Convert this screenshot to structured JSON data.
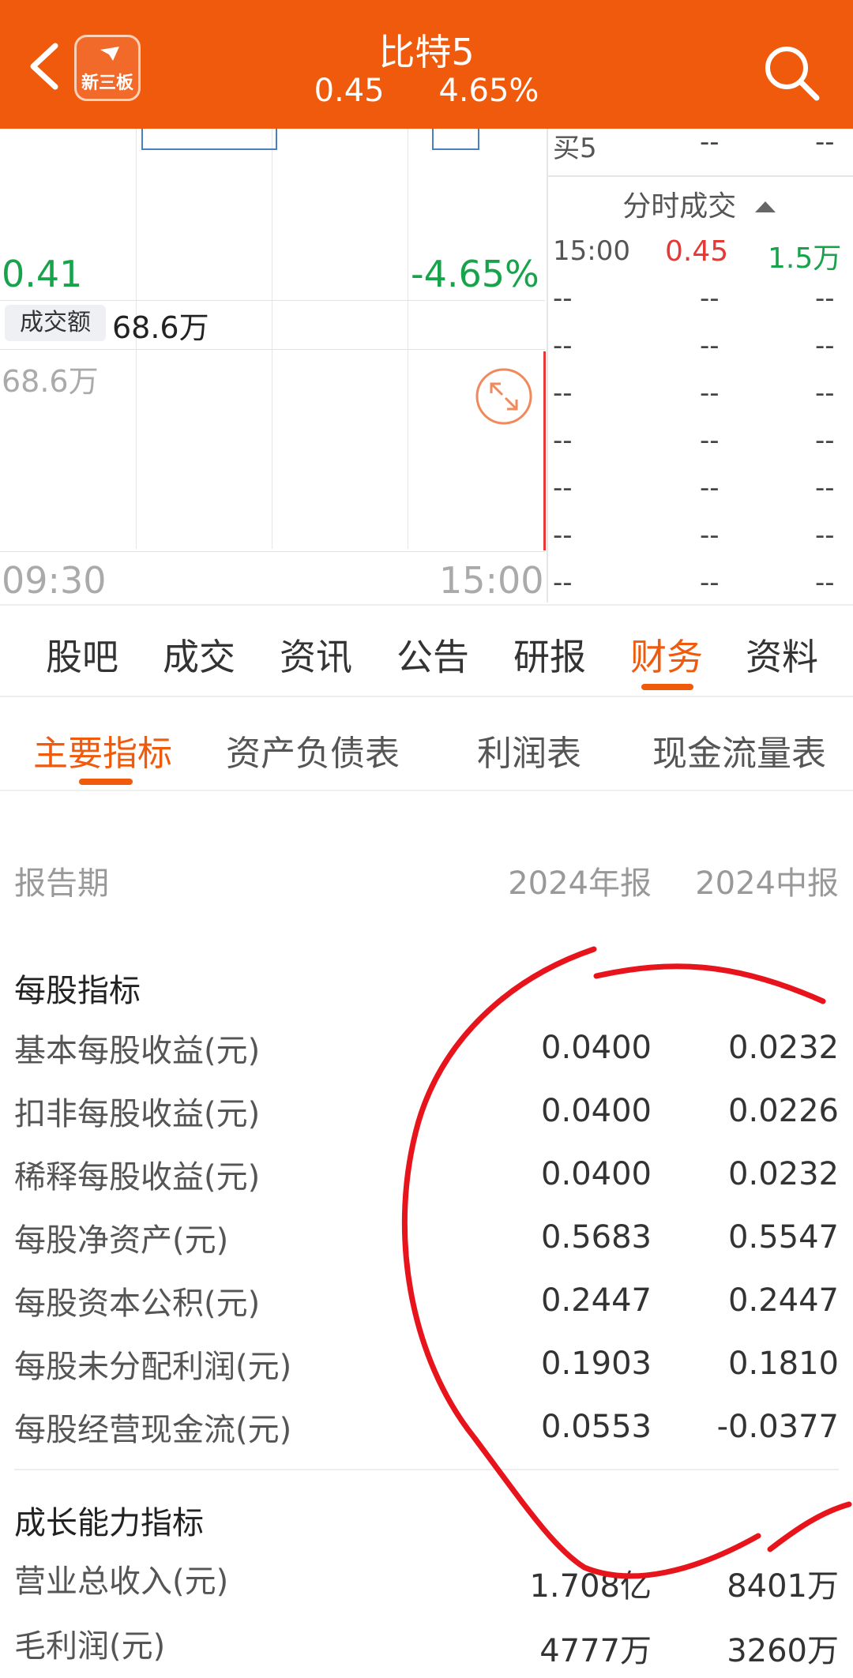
{
  "header": {
    "back_icon": "chevron-left-icon",
    "logo_text": "新三板",
    "title": "比特5",
    "price": "0.45",
    "change_pct": "4.65%",
    "search_icon": "search-icon",
    "color": "#f05a0c"
  },
  "chart": {
    "price_low": "0.41",
    "pct_low": "-4.65%",
    "turnover_label": "成交额",
    "turnover_value": "68.6万",
    "volume_label": "68.6万",
    "time_start": "09:30",
    "time_end": "15:00",
    "expand_icon": "expand-icon"
  },
  "order_book": {
    "buy5_label": "买5",
    "buy5_price": "--",
    "buy5_vol": "--"
  },
  "trades": {
    "title": "分时成交",
    "title_icon": "triangle-up-icon",
    "rows": [
      {
        "time": "15:00",
        "price": "0.45",
        "vol": "1.5万"
      },
      {
        "time": "--",
        "price": "--",
        "vol": "--"
      },
      {
        "time": "--",
        "price": "--",
        "vol": "--"
      },
      {
        "time": "--",
        "price": "--",
        "vol": "--"
      },
      {
        "time": "--",
        "price": "--",
        "vol": "--"
      },
      {
        "time": "--",
        "price": "--",
        "vol": "--"
      },
      {
        "time": "--",
        "price": "--",
        "vol": "--"
      },
      {
        "time": "--",
        "price": "--",
        "vol": "--"
      }
    ]
  },
  "tabs": [
    "股吧",
    "成交",
    "资讯",
    "公告",
    "研报",
    "财务",
    "资料"
  ],
  "active_tab": "财务",
  "subtabs": [
    "主要指标",
    "资产负债表",
    "利润表",
    "现金流量表"
  ],
  "active_subtab": "主要指标",
  "table": {
    "period_label": "报告期",
    "col1": "2024年报",
    "col2": "2024中报",
    "section1": "每股指标",
    "rows1": [
      {
        "label": "基本每股收益(元)",
        "v1": "0.0400",
        "v2": "0.0232"
      },
      {
        "label": "扣非每股收益(元)",
        "v1": "0.0400",
        "v2": "0.0226"
      },
      {
        "label": "稀释每股收益(元)",
        "v1": "0.0400",
        "v2": "0.0232"
      },
      {
        "label": "每股净资产(元)",
        "v1": "0.5683",
        "v2": "0.5547"
      },
      {
        "label": "每股资本公积(元)",
        "v1": "0.2447",
        "v2": "0.2447"
      },
      {
        "label": "每股未分配利润(元)",
        "v1": "0.1903",
        "v2": "0.1810"
      },
      {
        "label": "每股经营现金流(元)",
        "v1": "0.0553",
        "v2": "-0.0377"
      }
    ],
    "section2": "成长能力指标",
    "rows2": [
      {
        "label": "营业总收入(元)",
        "v1": "1.708亿",
        "v2": "8401万"
      },
      {
        "label": "毛利润(元)",
        "v1": "4777万",
        "v2": "3260万"
      }
    ]
  },
  "colors": {
    "up": "#e53935",
    "down": "#17a34a",
    "accent": "#f05a0c",
    "annotation": "#e8141c"
  }
}
